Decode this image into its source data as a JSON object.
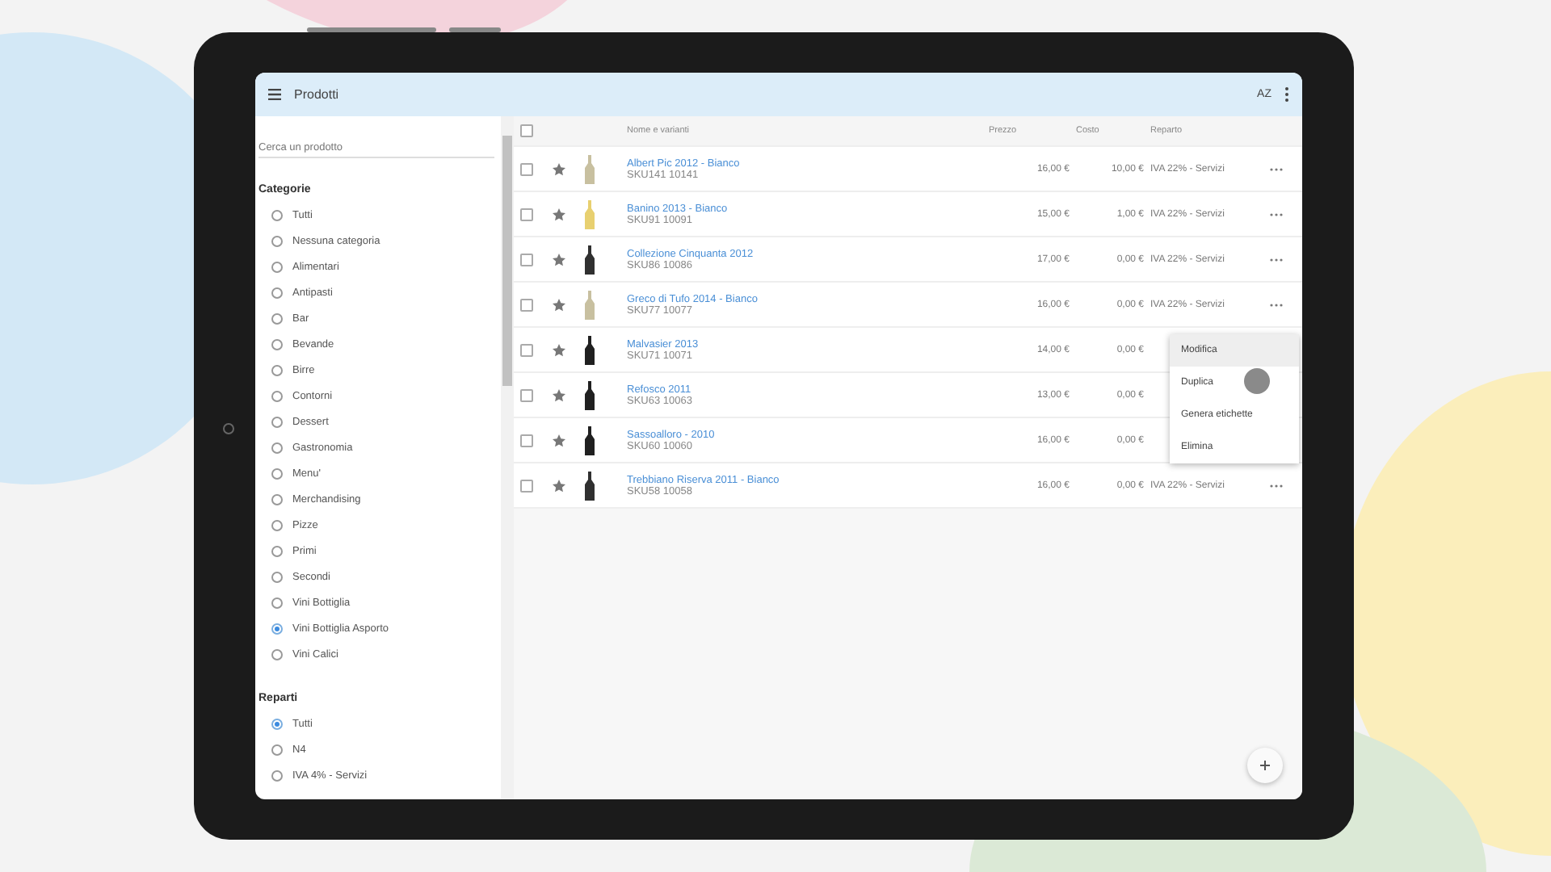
{
  "header": {
    "title": "Prodotti",
    "sort_label": "AZ"
  },
  "sidebar": {
    "search": {
      "placeholder": "Cerca un prodotto"
    },
    "sections": [
      {
        "title": "Categorie",
        "items": [
          {
            "label": "Tutti",
            "selected": false
          },
          {
            "label": "Nessuna categoria",
            "selected": false
          },
          {
            "label": "Alimentari",
            "selected": false
          },
          {
            "label": "Antipasti",
            "selected": false
          },
          {
            "label": "Bar",
            "selected": false
          },
          {
            "label": "Bevande",
            "selected": false
          },
          {
            "label": "Birre",
            "selected": false
          },
          {
            "label": "Contorni",
            "selected": false
          },
          {
            "label": "Dessert",
            "selected": false
          },
          {
            "label": "Gastronomia",
            "selected": false
          },
          {
            "label": "Menu'",
            "selected": false
          },
          {
            "label": "Merchandising",
            "selected": false
          },
          {
            "label": "Pizze",
            "selected": false
          },
          {
            "label": "Primi",
            "selected": false
          },
          {
            "label": "Secondi",
            "selected": false
          },
          {
            "label": "Vini Bottiglia",
            "selected": false
          },
          {
            "label": "Vini Bottiglia Asporto",
            "selected": true
          },
          {
            "label": "Vini Calici",
            "selected": false
          }
        ]
      },
      {
        "title": "Reparti",
        "items": [
          {
            "label": "Tutti",
            "selected": true
          },
          {
            "label": "N4",
            "selected": false
          },
          {
            "label": "IVA 4% - Servizi",
            "selected": false
          }
        ]
      }
    ]
  },
  "table": {
    "select_all_checked": false,
    "columns": [
      "Nome e varianti",
      "Prezzo",
      "Costo",
      "Reparto"
    ],
    "rows": [
      {
        "name": "Albert Pic 2012 - Bianco",
        "sku": "SKU141 10141",
        "price": "16,00 €",
        "cost": "10,00 €",
        "department": "IVA 22% - Servizi",
        "color": "#c8c0a0",
        "checked": false
      },
      {
        "name": "Banino 2013 - Bianco",
        "sku": "SKU91 10091",
        "price": "15,00 €",
        "cost": "1,00 €",
        "department": "IVA 22% - Servizi",
        "color": "#e8d070",
        "checked": false
      },
      {
        "name": "Collezione Cinquanta 2012",
        "sku": "SKU86 10086",
        "price": "17,00 €",
        "cost": "0,00 €",
        "department": "IVA 22% - Servizi",
        "color": "#303030",
        "checked": false
      },
      {
        "name": "Greco di Tufo 2014 - Bianco",
        "sku": "SKU77 10077",
        "price": "16,00 €",
        "cost": "0,00 €",
        "department": "IVA 22% - Servizi",
        "color": "#c8c0a0",
        "checked": false
      },
      {
        "name": "Malvasier 2013",
        "sku": "SKU71 10071",
        "price": "14,00 €",
        "cost": "0,00 €",
        "checked": false,
        "color": "#202020"
      },
      {
        "name": "Refosco 2011",
        "sku": "SKU63 10063",
        "price": "13,00 €",
        "cost": "0,00 €",
        "checked": false,
        "color": "#202020"
      },
      {
        "name": "Sassoalloro - 2010",
        "sku": "SKU60 10060",
        "price": "16,00 €",
        "cost": "0,00 €",
        "checked": false,
        "color": "#202020"
      },
      {
        "name": "Trebbiano Riserva 2011 - Bianco",
        "sku": "SKU58 10058",
        "price": "16,00 €",
        "cost": "0,00 €",
        "department": "IVA 22% - Servizi",
        "color": "#303030",
        "checked": false
      }
    ]
  },
  "menu": {
    "items": [
      {
        "label": "Modifica",
        "selected": true
      },
      {
        "label": "Duplica",
        "selected": false
      },
      {
        "label": "Genera etichette",
        "selected": false
      },
      {
        "label": "Elimina",
        "selected": false
      }
    ]
  }
}
